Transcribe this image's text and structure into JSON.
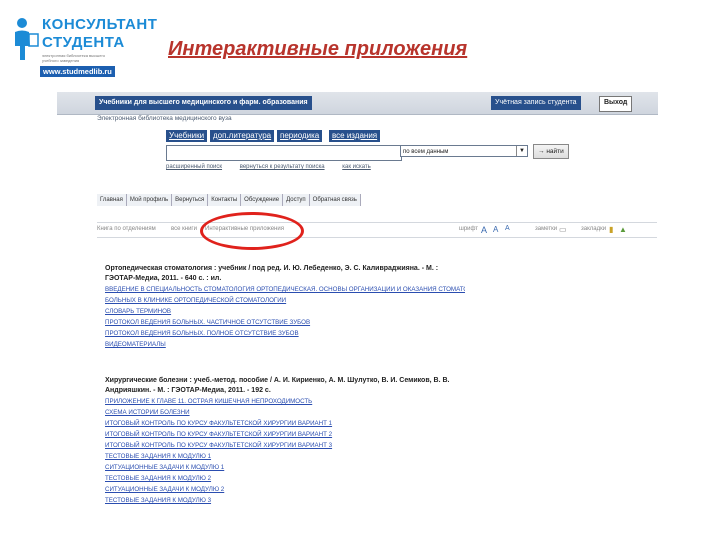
{
  "slide": {
    "title": "Интерактивные приложения",
    "logo": {
      "line1": "КОНСУЛЬТАНТ",
      "line2": "СТУДЕНТА",
      "tagline": "электронная библиотека высшего учебного заведения",
      "url": "www.studmedlib.ru"
    }
  },
  "app": {
    "header_title": "Учебники для высшего медицинского и фарм. образования",
    "subtitle": "Электронная библиотека медицинского вуза",
    "user_label": "Учётная запись студента",
    "exit_label": "Выход",
    "tabs": [
      {
        "label": "Учебники"
      },
      {
        "label": "доп.литература"
      },
      {
        "label": "периодика"
      },
      {
        "label": "все издания"
      }
    ],
    "search": {
      "placeholder": "",
      "scope": "по всем данным",
      "go_label": "найти",
      "links": [
        "расширенный поиск",
        "вернуться к результату поиска",
        "как искать"
      ]
    },
    "nav": [
      "Главная",
      "Мой профиль",
      "Вернуться",
      "Контакты",
      "Обсуждение",
      "Доступ",
      "Обратная связь"
    ],
    "tools": {
      "toc_label": "Книга по отделениям",
      "all_label": "все книги",
      "active_label": "Интерактивные приложения",
      "font_label": "шрифт",
      "font_a": "A",
      "font_b": "A",
      "font_c": "A",
      "fav_label": "заметки",
      "bookmark_label": "закладки"
    },
    "books": [
      {
        "title": "Ортопедическая стоматология : учебник / под ред. И. Ю. Лебеденко, Э. С. Каливраджияна. - М. : ГЭОТАР-Медиа, 2011. - 640 с. : ил.",
        "links": [
          "ВВЕДЕНИЕ В СПЕЦИАЛЬНОСТЬ СТОМАТОЛОГИЯ ОРТОПЕДИЧЕСКАЯ. ОСНОВЫ ОРГАНИЗАЦИИ И ОКАЗАНИЯ СТОМАТОЛОГИЧЕСКОЙ ОРТОПЕДИЧЕСКОЙ ПОМОЩИ В РОССИЙСКОЙ ФЕДЕРАЦИИ. МЕТОДЫ ОБСЛЕДОВАНИЯ",
          "БОЛЬНЫХ В КЛИНИКЕ ОРТОПЕДИЧЕСКОЙ СТОМАТОЛОГИИ",
          "СЛОВАРЬ ТЕРМИНОВ",
          "ПРОТОКОЛ ВЕДЕНИЯ БОЛЬНЫХ. ЧАСТИЧНОЕ ОТСУТСТВИЕ ЗУБОВ",
          "ПРОТОКОЛ ВЕДЕНИЯ БОЛЬНЫХ. ПОЛНОЕ ОТСУТСТВИЕ ЗУБОВ",
          "ВИДЕОМАТЕРИАЛЫ"
        ]
      },
      {
        "title": "Хирургические болезни : учеб.-метод. пособие / А. И. Кириенко, А. М. Шулутко, В. И. Семиков, В. В. Андрияшкин. - М. : ГЭОТАР-Медиа, 2011. - 192 с.",
        "links": [
          "ПРИЛОЖЕНИЕ К ГЛАВЕ 11. ОСТРАЯ КИШЕЧНАЯ НЕПРОХОДИМОСТЬ",
          "СХЕМА ИСТОРИИ БОЛЕЗНИ",
          "ИТОГОВЫЙ КОНТРОЛЬ ПО КУРСУ ФАКУЛЬТЕТСКОЙ ХИРУРГИИ ВАРИАНТ 1",
          "ИТОГОВЫЙ КОНТРОЛЬ ПО КУРСУ ФАКУЛЬТЕТСКОЙ ХИРУРГИИ ВАРИАНТ 2",
          "ИТОГОВЫЙ КОНТРОЛЬ ПО КУРСУ ФАКУЛЬТЕТСКОЙ ХИРУРГИИ ВАРИАНТ 3",
          "ТЕСТОВЫЕ ЗАДАНИЯ К МОДУЛЮ 1",
          "СИТУАЦИОННЫЕ ЗАДАЧИ К МОДУЛЮ 1",
          "ТЕСТОВЫЕ ЗАДАНИЯ К МОДУЛЮ 2",
          "СИТУАЦИОННЫЕ ЗАДАЧИ К МОДУЛЮ 2",
          "ТЕСТОВЫЕ ЗАДАНИЯ К МОДУЛЮ 3"
        ]
      }
    ]
  },
  "colors": {
    "title": "#b8342c",
    "brand": "#1c8bd6",
    "header_bar": "#28508c",
    "link": "#2a4db0",
    "highlight": "#e0221c"
  }
}
